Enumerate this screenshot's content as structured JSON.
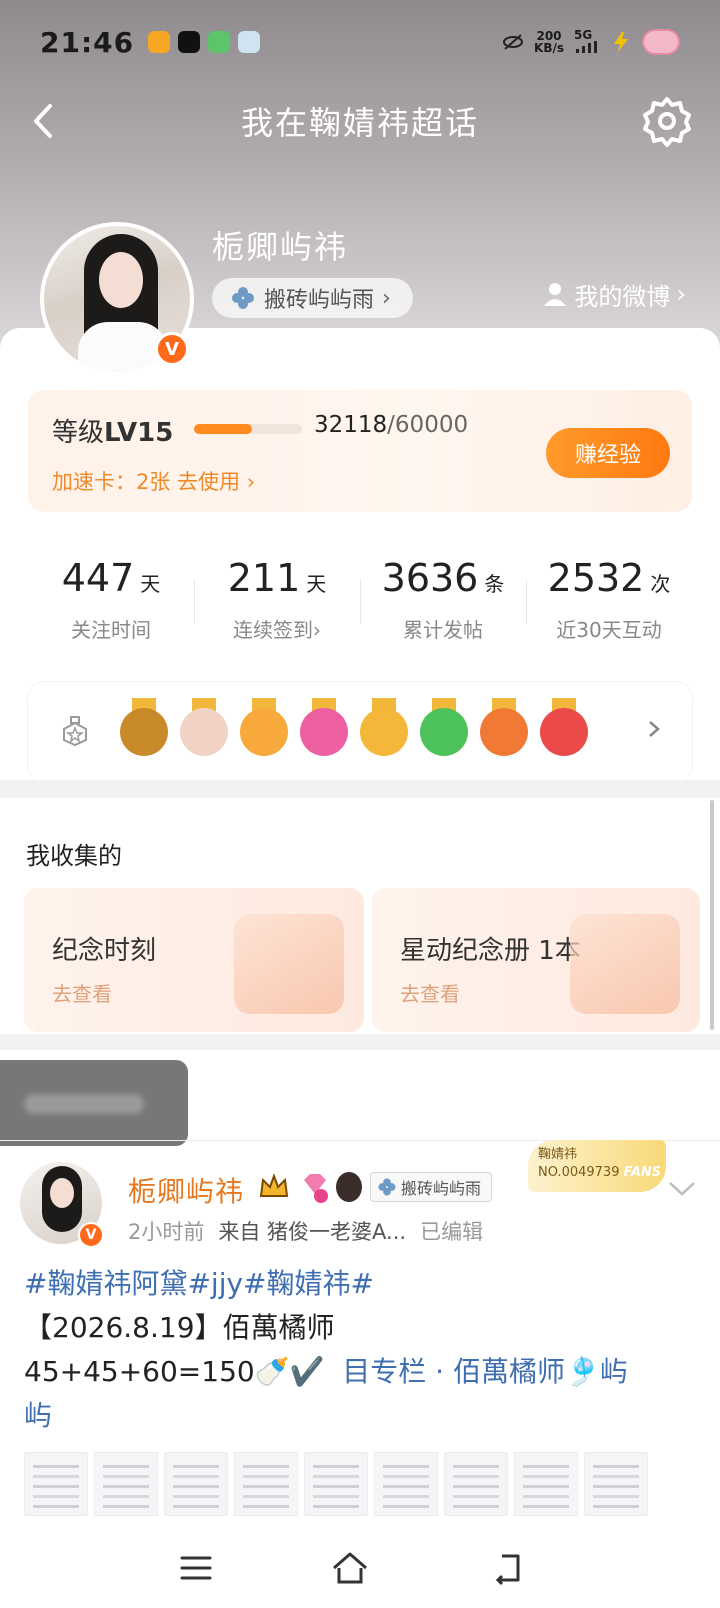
{
  "status_bar": {
    "time": "21:46",
    "speed_value": "200",
    "speed_unit": "KB/s",
    "network": "5G"
  },
  "nav": {
    "title": "我在鞠婧祎超话"
  },
  "profile": {
    "name": "栀卿屿祎",
    "title_badge": "搬砖屿屿雨",
    "verified_mark": "V",
    "my_weibo_label": "我的微博"
  },
  "level": {
    "label_prefix": "等级",
    "label_level": "LV15",
    "current": "32118",
    "max": "/60000",
    "progress_fraction": 0.536,
    "speed_card": "加速卡：2张 去使用",
    "earn_button": "赚经验"
  },
  "stats": [
    {
      "value": "447",
      "unit": "天",
      "label": "关注时间"
    },
    {
      "value": "211",
      "unit": "天",
      "label": "连续签到"
    },
    {
      "value": "3636",
      "unit": "条",
      "label": "累计发帖"
    },
    {
      "value": "2532",
      "unit": "次",
      "label": "近30天互动"
    }
  ],
  "badges": [
    {
      "name": "super-medal-icon",
      "color": "#c98a2a"
    },
    {
      "name": "avatar-medal-icon",
      "color": "#f1d3c6"
    },
    {
      "name": "crown-medal-icon",
      "color": "#f7a93b"
    },
    {
      "name": "lv15-medal-icon",
      "color": "#ec5fa0"
    },
    {
      "name": "hi-medal-icon",
      "color": "#f5b73a"
    },
    {
      "name": "hand-medal-icon",
      "color": "#4dc25a"
    },
    {
      "name": "100days-medal-icon",
      "color": "#f07a34"
    },
    {
      "name": "trophy-medal-icon",
      "color": "#ea4a4a"
    }
  ],
  "collection": {
    "title": "我收集的",
    "cards": [
      {
        "title": "纪念时刻",
        "subtitle": "去查看"
      },
      {
        "title": "星动纪念册 1本",
        "subtitle": "去查看"
      }
    ]
  },
  "post": {
    "author": "栀卿屿祎",
    "author_tag": "搬砖屿屿雨",
    "fans_badge_name": "鞠婧祎",
    "fans_badge_no": "NO.0049739",
    "fans_badge_word": "FANS",
    "time": "2小时前",
    "source": "来自 猪俊一老婆A...",
    "edited": "已编辑",
    "line1_tags": "#鞠婧祎阿黛#jjy#鞠婧祎#",
    "line2": "【2026.8.19】佰萬橘师",
    "line3_text": "45+45+60=150🍼✔️",
    "line3_link": "目专栏 · 佰萬橘师",
    "line3_tail": "🎐屿",
    "line4": "屿"
  },
  "colors": {
    "accent_orange": "#ff7a10",
    "link_blue": "#3f6fb0",
    "name_orange": "#e8771d"
  }
}
